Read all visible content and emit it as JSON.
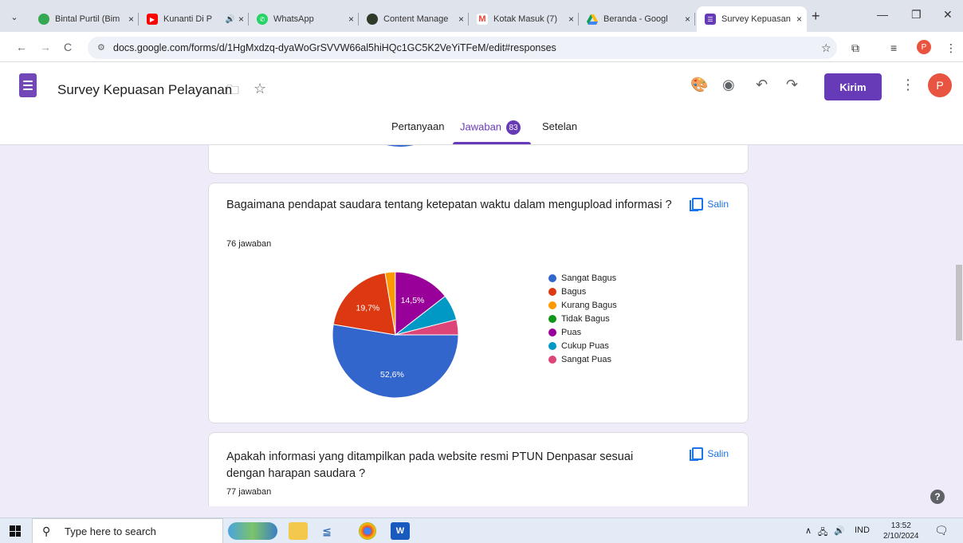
{
  "browser": {
    "tabs": [
      {
        "title": "Bintal Purtil (Bim",
        "favicon": "circle-green-icon",
        "color": "#34a853"
      },
      {
        "title": "Kunanti Di P",
        "favicon": "youtube-icon",
        "color": "#ff0000"
      },
      {
        "title": "WhatsApp",
        "favicon": "whatsapp-icon",
        "color": "#25d366"
      },
      {
        "title": "Content Manage",
        "favicon": "content-icon",
        "color": "#2f3b2a"
      },
      {
        "title": "Kotak Masuk (7)",
        "favicon": "gmail-icon",
        "color": "#ea4335"
      },
      {
        "title": "Beranda - Googl",
        "favicon": "drive-icon",
        "color": "#1a73e8"
      },
      {
        "title": "Survey Kepuasan",
        "favicon": "forms-icon",
        "color": "#673ab7"
      }
    ],
    "tab_close": "×",
    "new_tab": "+",
    "url": "docs.google.com/forms/d/1HgMxdzq-dyaWoGrSVVW66al5hiHQc1GC5K2VeYiTFeM/edit#responses",
    "profile_initial": "P"
  },
  "form": {
    "title": "Survey Kepuasan Pelayanan",
    "send_label": "Kirim",
    "avatar_initial": "P",
    "tabs": {
      "questions": "Pertanyaan",
      "responses": "Jawaban",
      "responses_count": "83",
      "settings": "Setelan"
    }
  },
  "questions": [
    {
      "title": "Bagaimana pendapat saudara tentang ketepatan waktu dalam mengupload informasi ?",
      "count": "76 jawaban",
      "copy_label": "Salin",
      "chart_data": {
        "type": "pie",
        "categories": [
          "Sangat Bagus",
          "Bagus",
          "Kurang Bagus",
          "Tidak Bagus",
          "Puas",
          "Cukup Puas",
          "Sangat Puas"
        ],
        "values": [
          52.6,
          19.7,
          2.6,
          0,
          14.5,
          6.6,
          3.9
        ],
        "colors": [
          "#3366cc",
          "#dc3912",
          "#ff9900",
          "#109618",
          "#990099",
          "#0099c6",
          "#dd4477"
        ],
        "slice_labels": [
          "52,6%",
          "19,7%",
          "",
          "",
          "14,5%",
          "",
          ""
        ]
      }
    },
    {
      "title": "Apakah informasi yang ditampilkan pada website resmi PTUN Denpasar sesuai dengan harapan saudara ?",
      "count": "77 jawaban",
      "copy_label": "Salin"
    }
  ],
  "taskbar": {
    "search_placeholder": "Type here to search",
    "language": "IND",
    "time": "13:52",
    "date": "2/10/2024"
  }
}
